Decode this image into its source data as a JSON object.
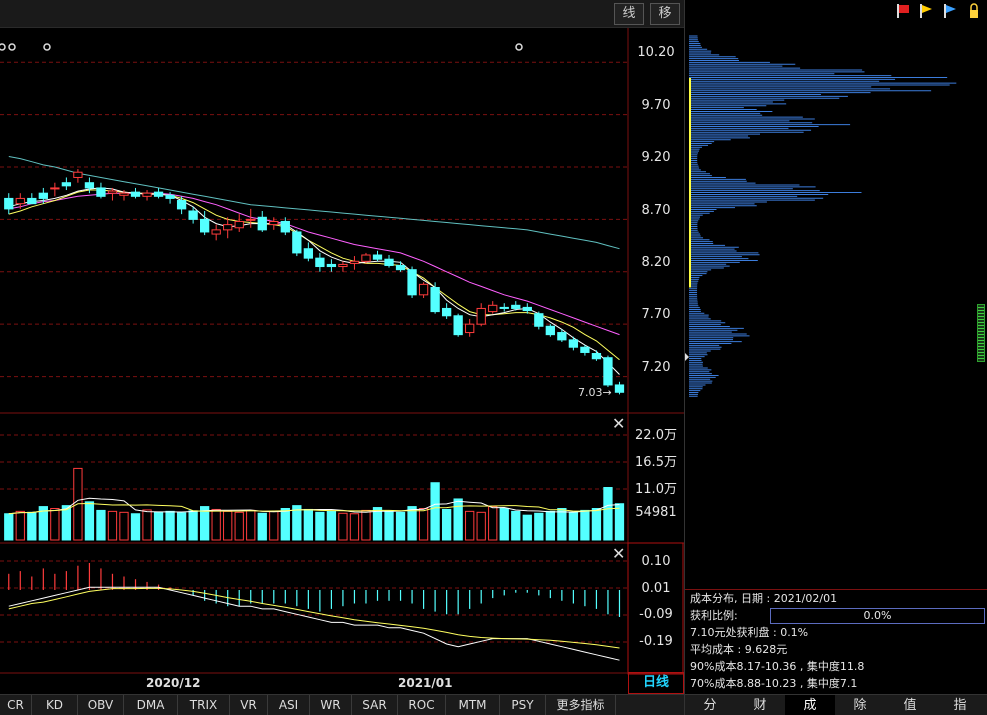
{
  "toolbar": {
    "btn_line": "线",
    "btn_move": "移"
  },
  "price_axis": [
    "10.20",
    "9.70",
    "9.20",
    "8.70",
    "8.20",
    "7.70",
    "7.20"
  ],
  "last_price_marker": "7.03→",
  "volume_axis": [
    "22.0万",
    "16.5万",
    "11.0万",
    "54981"
  ],
  "macd_axis": [
    "0.10",
    "0.01",
    "-0.09",
    "-0.19"
  ],
  "dates": [
    "2020/12",
    "2021/01"
  ],
  "period_label": "日线",
  "indicator_tabs": [
    "CR",
    "KD",
    "OBV",
    "DMA",
    "TRIX",
    "VR",
    "ASI",
    "WR",
    "SAR",
    "ROC",
    "MTM",
    "PSY",
    "更多指标"
  ],
  "chip_info": {
    "title": "成本分布, 日期 : 2021/02/01",
    "profit_label": "获利比例:",
    "profit_value": "0.0%",
    "profit_at": "7.10元处获利盘 : 0.1%",
    "avg_cost": "平均成本 : 9.628元",
    "cost90": "90%成本8.17-10.36 , 集中度11.8",
    "cost70": "70%成本8.88-10.23 , 集中度7.1"
  },
  "right_tabs": [
    "分",
    "财",
    "成",
    "除",
    "值",
    "指"
  ],
  "colors": {
    "up": "#ff3c3c",
    "down": "#54ffff",
    "ma5": "#ffffff",
    "ma10": "#ffff60",
    "ma20": "#ff60ff",
    "ma60": "#60c0c0",
    "chip": "#3c7ddc",
    "grid": "#7b1010"
  },
  "chart_data": {
    "type": "candlestick",
    "candles_ohlc": [
      [
        8.9,
        8.95,
        8.75,
        8.8
      ],
      [
        8.85,
        8.95,
        8.8,
        8.9
      ],
      [
        8.9,
        8.95,
        8.85,
        8.85
      ],
      [
        8.95,
        9.0,
        8.85,
        8.9
      ],
      [
        9.0,
        9.05,
        8.92,
        9.0
      ],
      [
        9.05,
        9.1,
        8.98,
        9.02
      ],
      [
        9.1,
        9.18,
        9.05,
        9.15
      ],
      [
        9.05,
        9.1,
        8.95,
        9.0
      ],
      [
        9.0,
        9.05,
        8.9,
        8.92
      ],
      [
        8.95,
        9.0,
        8.88,
        8.97
      ],
      [
        8.93,
        8.98,
        8.88,
        8.95
      ],
      [
        8.96,
        9.0,
        8.9,
        8.92
      ],
      [
        8.92,
        8.98,
        8.88,
        8.95
      ],
      [
        8.96,
        9.0,
        8.9,
        8.92
      ],
      [
        8.93,
        8.96,
        8.85,
        8.9
      ],
      [
        8.88,
        8.92,
        8.75,
        8.8
      ],
      [
        8.78,
        8.82,
        8.66,
        8.7
      ],
      [
        8.7,
        8.78,
        8.55,
        8.58
      ],
      [
        8.56,
        8.65,
        8.5,
        8.6
      ],
      [
        8.6,
        8.72,
        8.52,
        8.65
      ],
      [
        8.62,
        8.75,
        8.58,
        8.68
      ],
      [
        8.7,
        8.8,
        8.62,
        8.7
      ],
      [
        8.72,
        8.78,
        8.58,
        8.6
      ],
      [
        8.65,
        8.72,
        8.6,
        8.68
      ],
      [
        8.68,
        8.72,
        8.55,
        8.58
      ],
      [
        8.58,
        8.6,
        8.35,
        8.38
      ],
      [
        8.42,
        8.48,
        8.3,
        8.33
      ],
      [
        8.33,
        8.38,
        8.2,
        8.25
      ],
      [
        8.27,
        8.32,
        8.2,
        8.25
      ],
      [
        8.25,
        8.3,
        8.2,
        8.27
      ],
      [
        8.28,
        8.35,
        8.22,
        8.3
      ],
      [
        8.3,
        8.38,
        8.28,
        8.36
      ],
      [
        8.36,
        8.4,
        8.3,
        8.32
      ],
      [
        8.32,
        8.36,
        8.24,
        8.26
      ],
      [
        8.26,
        8.3,
        8.2,
        8.22
      ],
      [
        8.22,
        8.25,
        7.95,
        7.98
      ],
      [
        7.98,
        8.1,
        7.95,
        8.08
      ],
      [
        8.05,
        8.1,
        7.8,
        7.82
      ],
      [
        7.85,
        7.9,
        7.75,
        7.78
      ],
      [
        7.78,
        7.8,
        7.58,
        7.6
      ],
      [
        7.62,
        7.75,
        7.58,
        7.7
      ],
      [
        7.7,
        7.9,
        7.68,
        7.85
      ],
      [
        7.82,
        7.92,
        7.8,
        7.88
      ],
      [
        7.86,
        7.9,
        7.82,
        7.85
      ],
      [
        7.88,
        7.92,
        7.83,
        7.85
      ],
      [
        7.86,
        7.9,
        7.8,
        7.83
      ],
      [
        7.8,
        7.82,
        7.65,
        7.68
      ],
      [
        7.68,
        7.7,
        7.58,
        7.6
      ],
      [
        7.62,
        7.65,
        7.53,
        7.55
      ],
      [
        7.55,
        7.58,
        7.45,
        7.48
      ],
      [
        7.48,
        7.5,
        7.4,
        7.43
      ],
      [
        7.42,
        7.45,
        7.35,
        7.37
      ],
      [
        7.38,
        7.4,
        7.1,
        7.12
      ],
      [
        7.12,
        7.15,
        7.03,
        7.05
      ]
    ],
    "ma_series": [
      {
        "name": "MA60",
        "values": [
          9.3,
          9.28,
          9.25,
          9.22,
          9.2,
          9.17,
          9.14,
          9.12,
          9.1,
          9.08,
          9.06,
          9.04,
          9.02,
          9.0,
          8.98,
          8.96,
          8.94,
          8.92,
          8.9,
          8.88,
          8.86,
          8.84,
          8.83,
          8.82,
          8.81,
          8.8,
          8.79,
          8.78,
          8.77,
          8.76,
          8.75,
          8.74,
          8.73,
          8.72,
          8.71,
          8.7,
          8.69,
          8.68,
          8.67,
          8.66,
          8.65,
          8.64,
          8.63,
          8.62,
          8.61,
          8.6,
          8.58,
          8.56,
          8.54,
          8.52,
          8.5,
          8.48,
          8.45,
          8.42
        ]
      },
      {
        "name": "MA20",
        "values": [
          8.8,
          8.82,
          8.85,
          8.87,
          8.88,
          8.9,
          8.92,
          8.93,
          8.94,
          8.95,
          8.95,
          8.95,
          8.95,
          8.95,
          8.94,
          8.92,
          8.9,
          8.87,
          8.84,
          8.8,
          8.76,
          8.72,
          8.7,
          8.68,
          8.66,
          8.62,
          8.58,
          8.55,
          8.52,
          8.49,
          8.46,
          8.44,
          8.42,
          8.4,
          8.38,
          8.34,
          8.3,
          8.25,
          8.2,
          8.15,
          8.1,
          8.06,
          8.02,
          7.98,
          7.95,
          7.92,
          7.88,
          7.84,
          7.8,
          7.76,
          7.72,
          7.68,
          7.64,
          7.6
        ]
      },
      {
        "name": "MA10",
        "values": [
          8.75,
          8.78,
          8.82,
          8.85,
          8.88,
          8.92,
          8.96,
          8.98,
          8.98,
          8.97,
          8.96,
          8.95,
          8.95,
          8.94,
          8.93,
          8.9,
          8.86,
          8.8,
          8.74,
          8.7,
          8.68,
          8.67,
          8.66,
          8.65,
          8.63,
          8.57,
          8.5,
          8.44,
          8.38,
          8.33,
          8.3,
          8.28,
          8.28,
          8.27,
          8.26,
          8.2,
          8.14,
          8.05,
          7.97,
          7.89,
          7.82,
          7.79,
          7.79,
          7.8,
          7.81,
          7.81,
          7.79,
          7.76,
          7.72,
          7.67,
          7.6,
          7.54,
          7.45,
          7.36
        ]
      },
      {
        "name": "MA5",
        "values": [
          8.82,
          8.85,
          8.87,
          8.88,
          8.9,
          8.93,
          8.97,
          8.99,
          9.0,
          8.99,
          8.96,
          8.95,
          8.94,
          8.94,
          8.93,
          8.88,
          8.82,
          8.72,
          8.66,
          8.63,
          8.64,
          8.66,
          8.66,
          8.66,
          8.65,
          8.58,
          8.5,
          8.4,
          8.34,
          8.3,
          8.28,
          8.29,
          8.3,
          8.3,
          8.29,
          8.2,
          8.12,
          8.05,
          7.93,
          7.85,
          7.79,
          7.77,
          7.79,
          7.81,
          7.84,
          7.85,
          7.8,
          7.72,
          7.65,
          7.57,
          7.5,
          7.44,
          7.33,
          7.22
        ]
      }
    ],
    "volume": [
      55000,
      60000,
      58000,
      70000,
      66000,
      72000,
      150000,
      80000,
      62000,
      60000,
      58000,
      55000,
      63000,
      58000,
      60000,
      57000,
      61000,
      70000,
      64000,
      60000,
      58000,
      62000,
      56000,
      60000,
      66000,
      72000,
      64000,
      58000,
      60000,
      56000,
      55000,
      62000,
      68000,
      60000,
      58000,
      70000,
      66000,
      120000,
      64000,
      86000,
      60000,
      58000,
      70000,
      66000,
      60000,
      52000,
      56000,
      60000,
      66000,
      58000,
      62000,
      66000,
      110000,
      76000
    ],
    "macd_hist": [
      0.06,
      0.07,
      0.05,
      0.08,
      0.06,
      0.07,
      0.09,
      0.1,
      0.08,
      0.06,
      0.05,
      0.04,
      0.03,
      0.02,
      0.01,
      0.0,
      -0.02,
      -0.04,
      -0.05,
      -0.06,
      -0.06,
      -0.05,
      -0.05,
      -0.05,
      -0.05,
      -0.06,
      -0.07,
      -0.08,
      -0.07,
      -0.06,
      -0.05,
      -0.05,
      -0.04,
      -0.04,
      -0.04,
      -0.05,
      -0.07,
      -0.08,
      -0.09,
      -0.09,
      -0.07,
      -0.05,
      -0.03,
      -0.02,
      -0.01,
      -0.01,
      -0.02,
      -0.03,
      -0.04,
      -0.05,
      -0.06,
      -0.07,
      -0.09,
      -0.1
    ],
    "dif": [
      -0.06,
      -0.05,
      -0.04,
      -0.03,
      -0.02,
      -0.01,
      0.0,
      0.01,
      0.01,
      0.01,
      0.01,
      0.01,
      0.01,
      0.01,
      0.0,
      -0.01,
      -0.02,
      -0.03,
      -0.04,
      -0.05,
      -0.06,
      -0.06,
      -0.07,
      -0.07,
      -0.08,
      -0.09,
      -0.1,
      -0.11,
      -0.12,
      -0.12,
      -0.13,
      -0.13,
      -0.13,
      -0.14,
      -0.14,
      -0.15,
      -0.16,
      -0.18,
      -0.2,
      -0.21,
      -0.2,
      -0.19,
      -0.18,
      -0.18,
      -0.18,
      -0.18,
      -0.19,
      -0.2,
      -0.21,
      -0.22,
      -0.23,
      -0.24,
      -0.25,
      -0.26
    ],
    "dea": [
      -0.07,
      -0.06,
      -0.05,
      -0.045,
      -0.035,
      -0.025,
      -0.015,
      -0.005,
      0.0,
      0.005,
      0.005,
      0.005,
      0.006,
      0.006,
      0.004,
      0.0,
      -0.005,
      -0.012,
      -0.02,
      -0.028,
      -0.035,
      -0.042,
      -0.05,
      -0.057,
      -0.064,
      -0.072,
      -0.08,
      -0.088,
      -0.096,
      -0.103,
      -0.11,
      -0.116,
      -0.121,
      -0.126,
      -0.131,
      -0.136,
      -0.142,
      -0.149,
      -0.157,
      -0.166,
      -0.172,
      -0.176,
      -0.178,
      -0.18,
      -0.181,
      -0.182,
      -0.184,
      -0.186,
      -0.19,
      -0.194,
      -0.198,
      -0.203,
      -0.209,
      -0.215
    ],
    "price_range": [
      6.9,
      10.45
    ],
    "chip_distribution_range": [
      7.0,
      10.45
    ]
  }
}
